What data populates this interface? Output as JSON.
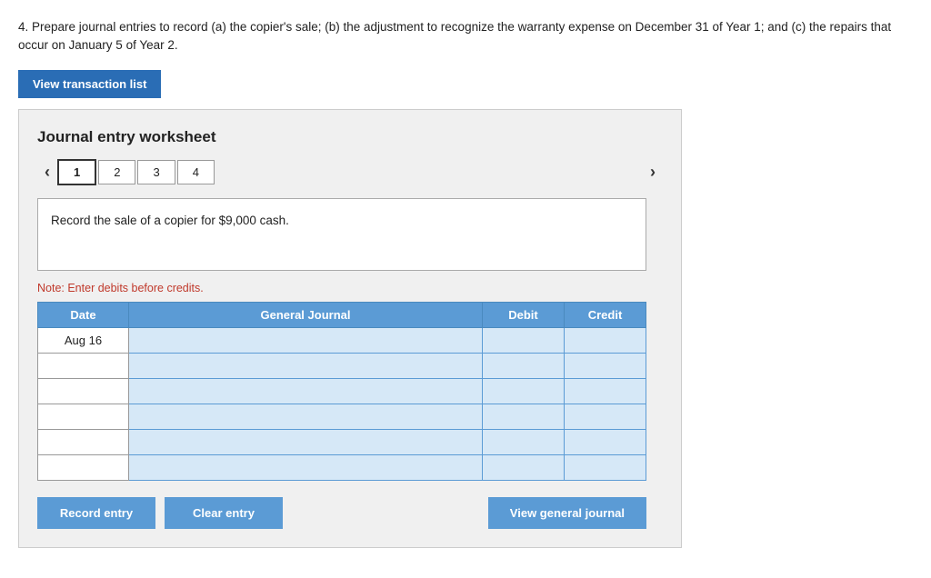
{
  "question": {
    "text": "4. Prepare journal entries to record (a) the copier's sale; (b) the adjustment to recognize the warranty expense on December 31 of Year 1; and (c) the repairs that occur on January 5 of Year 2."
  },
  "transaction_btn": "View transaction list",
  "worksheet": {
    "title": "Journal entry worksheet",
    "tabs": [
      {
        "label": "1",
        "active": true
      },
      {
        "label": "2",
        "active": false
      },
      {
        "label": "3",
        "active": false
      },
      {
        "label": "4",
        "active": false
      }
    ],
    "description": "Record the sale of a copier for $9,000 cash.",
    "note": "Note: Enter debits before credits.",
    "table": {
      "headers": [
        "Date",
        "General Journal",
        "Debit",
        "Credit"
      ],
      "rows": [
        {
          "date": "Aug 16",
          "journal": "",
          "debit": "",
          "credit": ""
        },
        {
          "date": "",
          "journal": "",
          "debit": "",
          "credit": ""
        },
        {
          "date": "",
          "journal": "",
          "debit": "",
          "credit": ""
        },
        {
          "date": "",
          "journal": "",
          "debit": "",
          "credit": ""
        },
        {
          "date": "",
          "journal": "",
          "debit": "",
          "credit": ""
        },
        {
          "date": "",
          "journal": "",
          "debit": "",
          "credit": ""
        }
      ]
    },
    "buttons": {
      "record": "Record entry",
      "clear": "Clear entry",
      "view": "View general journal"
    }
  }
}
